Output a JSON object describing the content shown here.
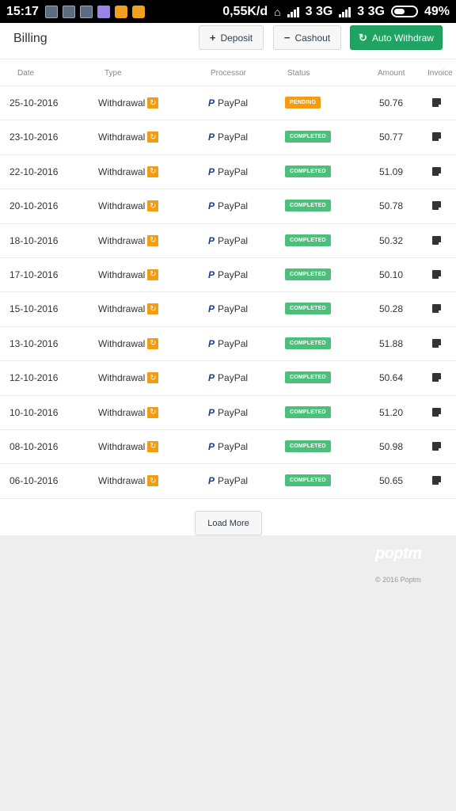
{
  "status_bar": {
    "time": "15:17",
    "network_speed": "0,55K/d",
    "signal1_label": "3 3G",
    "signal2_label": "3 3G",
    "battery": "49%"
  },
  "header": {
    "title": "Billing",
    "deposit_label": "Deposit",
    "cashout_label": "Cashout",
    "auto_withdraw_label": "Auto Withdraw"
  },
  "table": {
    "headers": {
      "date": "Date",
      "type": "Type",
      "processor": "Processor",
      "status": "Status",
      "amount": "Amount",
      "invoice": "Invoice"
    },
    "rows": [
      {
        "date": "25-10-2016",
        "type": "Withdrawal",
        "processor": "PayPal",
        "status": "PENDING",
        "amount": "50.76"
      },
      {
        "date": "23-10-2016",
        "type": "Withdrawal",
        "processor": "PayPal",
        "status": "COMPLETED",
        "amount": "50.77"
      },
      {
        "date": "22-10-2016",
        "type": "Withdrawal",
        "processor": "PayPal",
        "status": "COMPLETED",
        "amount": "51.09"
      },
      {
        "date": "20-10-2016",
        "type": "Withdrawal",
        "processor": "PayPal",
        "status": "COMPLETED",
        "amount": "50.78"
      },
      {
        "date": "18-10-2016",
        "type": "Withdrawal",
        "processor": "PayPal",
        "status": "COMPLETED",
        "amount": "50.32"
      },
      {
        "date": "17-10-2016",
        "type": "Withdrawal",
        "processor": "PayPal",
        "status": "COMPLETED",
        "amount": "50.10"
      },
      {
        "date": "15-10-2016",
        "type": "Withdrawal",
        "processor": "PayPal",
        "status": "COMPLETED",
        "amount": "50.28"
      },
      {
        "date": "13-10-2016",
        "type": "Withdrawal",
        "processor": "PayPal",
        "status": "COMPLETED",
        "amount": "51.88"
      },
      {
        "date": "12-10-2016",
        "type": "Withdrawal",
        "processor": "PayPal",
        "status": "COMPLETED",
        "amount": "50.64"
      },
      {
        "date": "10-10-2016",
        "type": "Withdrawal",
        "processor": "PayPal",
        "status": "COMPLETED",
        "amount": "51.20"
      },
      {
        "date": "08-10-2016",
        "type": "Withdrawal",
        "processor": "PayPal",
        "status": "COMPLETED",
        "amount": "50.98"
      },
      {
        "date": "06-10-2016",
        "type": "Withdrawal",
        "processor": "PayPal",
        "status": "COMPLETED",
        "amount": "50.65"
      }
    ]
  },
  "load_more_label": "Load More",
  "footer": {
    "logo": "poptm",
    "copyright": "© 2016 Poptm"
  },
  "colors": {
    "accent_green": "#1fa463",
    "pending": "#f39c12",
    "completed": "#4cc07a"
  },
  "icons": {
    "deposit": "plus-icon",
    "cashout": "minus-icon",
    "auto_withdraw": "refresh-icon",
    "type": "refresh-icon",
    "processor": "paypal-icon",
    "invoice": "document-icon"
  }
}
